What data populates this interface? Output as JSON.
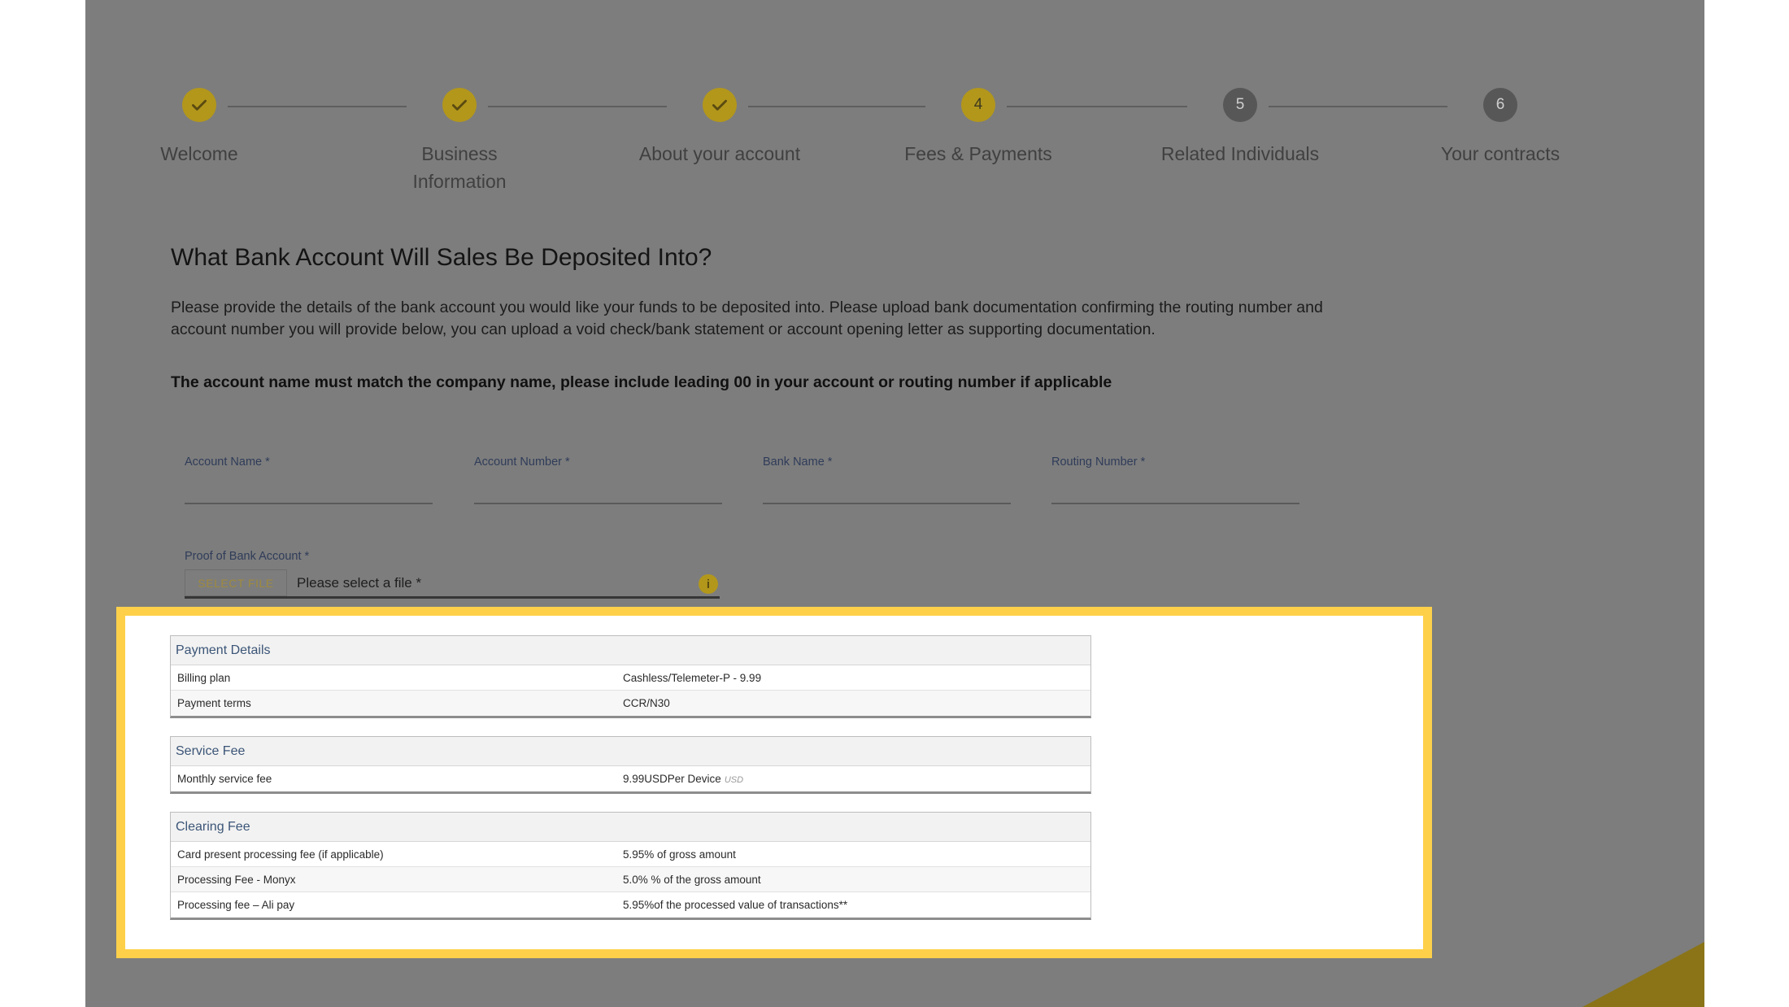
{
  "steps": [
    {
      "label": "Welcome",
      "state": "done"
    },
    {
      "label": "Business\nInformation",
      "state": "done"
    },
    {
      "label": "About your account",
      "state": "done"
    },
    {
      "label": "Fees & Payments",
      "number": "4",
      "state": "current"
    },
    {
      "label": "Related Individuals",
      "number": "5",
      "state": "todo"
    },
    {
      "label": "Your contracts",
      "number": "6",
      "state": "todo"
    }
  ],
  "page": {
    "title": "What Bank Account Will Sales Be Deposited Into?",
    "description": "Please provide the details of the bank account you would like your funds to be deposited into. Please upload bank documentation confirming the routing number and account number you will provide below, you can upload a void check/bank statement or account opening letter as supporting documentation.",
    "notice": "The account name must match the company name, please include leading 00 in your account or routing number if applicable"
  },
  "fields": {
    "account_name": "Account Name *",
    "account_number": "Account Number *",
    "bank_name": "Bank Name *",
    "routing_number": "Routing Number *"
  },
  "file_upload": {
    "label": "Proof of Bank Account *",
    "button": "SELECT FILE",
    "placeholder": "Please select a file *",
    "info_icon": "i"
  },
  "payment_details": {
    "title": "Payment Details",
    "rows": [
      {
        "key": "Billing plan",
        "value": "Cashless/Telemeter-P - 9.99"
      },
      {
        "key": "Payment terms",
        "value": "CCR/N30"
      }
    ]
  },
  "service_fee": {
    "title": "Service Fee",
    "rows": [
      {
        "key": "Monthly service fee",
        "value": "9.99USDPer Device",
        "unit": "USD"
      }
    ]
  },
  "clearing_fee": {
    "title": "Clearing Fee",
    "rows": [
      {
        "key": "Card present processing fee (if applicable)",
        "value": "5.95% of gross amount"
      },
      {
        "key": "Processing Fee - Monyx",
        "value": "5.0% % of the gross amount"
      },
      {
        "key": "Processing fee – Ali pay",
        "value": "5.95%of the processed value of transactions**"
      }
    ]
  },
  "colors": {
    "accent": "#b3971b",
    "highlight": "#fed04a",
    "overlay": "#7d7d7d"
  }
}
